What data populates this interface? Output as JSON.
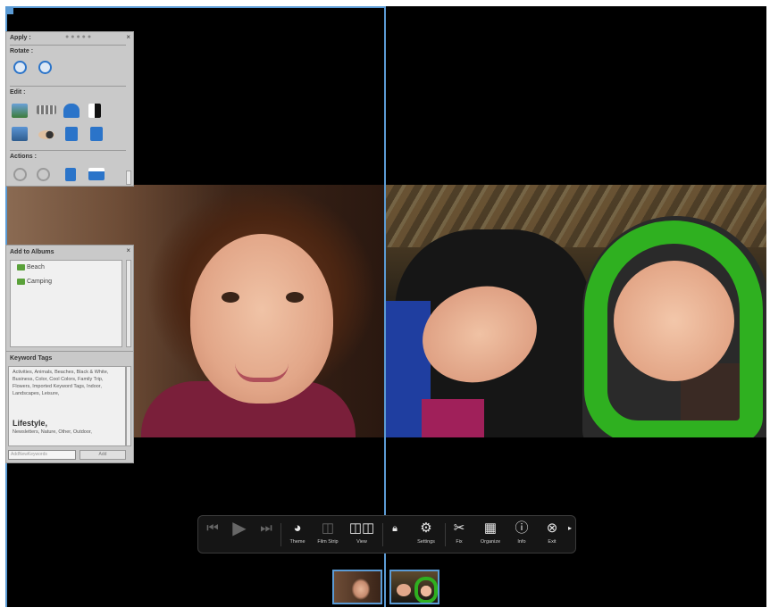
{
  "apply_panel": {
    "title": "Apply :",
    "rotate_label": "Rotate :",
    "edit_label": "Edit :",
    "actions_label": "Actions :",
    "close_glyph": "×"
  },
  "albums_panel": {
    "title": "Add to Albums",
    "items": [
      "Beach",
      "Camping"
    ],
    "close_glyph": "×"
  },
  "keywords_panel": {
    "title": "Keyword Tags",
    "tags_text": "Activities, Animals, Beaches, Black & White, Business, Color, Cool Colors, Family Trip, Flowers, Imported Keyword Tags, Indoor, Landscapes, Leisure,",
    "tag_emphasis": "Lifestyle,",
    "tags_tail": "Newsletters, Nature, Other, Outdoor,",
    "input_placeholder": "AddNewKeywords",
    "add_button": "Add"
  },
  "toolbar": {
    "theme": "Theme",
    "filmstrip": "Film Strip",
    "view": "View",
    "settings": "Settings",
    "fix": "Fix",
    "organize": "Organize",
    "info": "Info",
    "exit": "Exit"
  },
  "colors": {
    "accent": "#5b9bd5",
    "panel": "#c9c9c9",
    "toolbar": "#151515"
  }
}
